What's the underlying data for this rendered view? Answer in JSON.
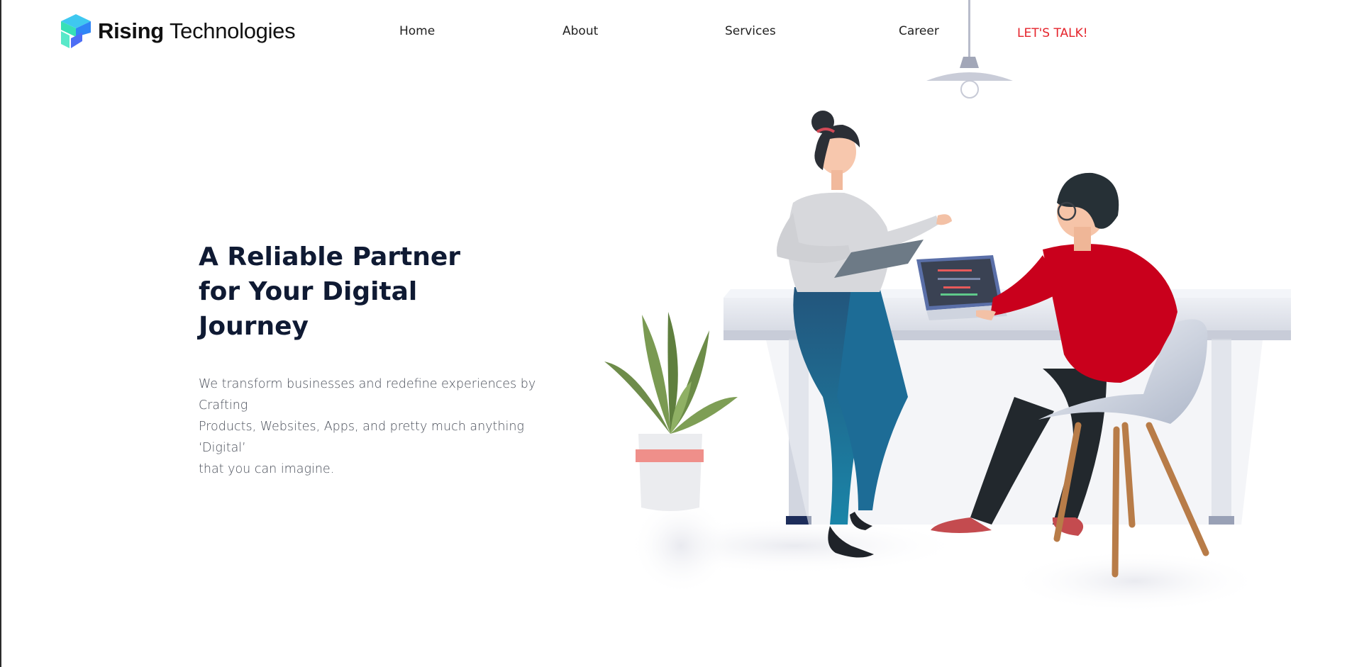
{
  "brand": {
    "name_bold": "Rising",
    "name_light": "Technologies"
  },
  "nav": {
    "home": "Home",
    "about": "About",
    "services": "Services",
    "career": "Career",
    "cta": "LET'S TALK!"
  },
  "hero": {
    "title_lines": [
      "A Reliable Partner",
      "for Your Digital",
      "Journey"
    ],
    "description_lines": [
      "We transform businesses and redefine experiences by Crafting",
      "Products, Websites, Apps, and pretty much anything ‘Digital’",
      "that you can imagine."
    ]
  },
  "colors": {
    "accent": "#e5232b",
    "heading": "#0f1a33",
    "body_text": "#4a4f5a"
  },
  "icons": {
    "logo": "cube-logo-icon",
    "lamp": "ceiling-lamp-illustration",
    "scene": "office-team-illustration"
  }
}
